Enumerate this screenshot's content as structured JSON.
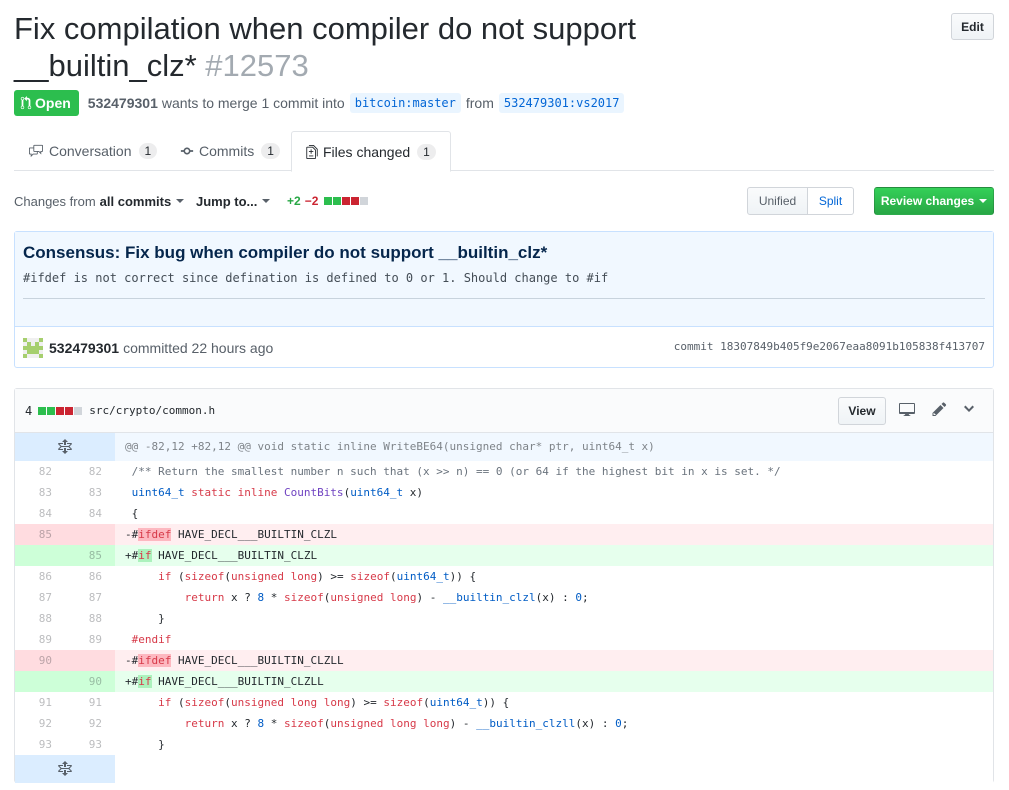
{
  "pr": {
    "title": "Fix compilation when compiler do not support __builtin_clz*",
    "number": "#12573",
    "state": "Open",
    "author": "532479301",
    "summary_prefix": "wants to merge 1 commit into",
    "base_branch": "bitcoin:master",
    "from_word": "from",
    "head_branch": "532479301:vs2017",
    "edit_label": "Edit"
  },
  "tabs": [
    {
      "label": "Conversation",
      "count": "1"
    },
    {
      "label": "Commits",
      "count": "1"
    },
    {
      "label": "Files changed",
      "count": "1"
    }
  ],
  "toolbar": {
    "changes_from": "Changes from",
    "changes_scope": "all commits",
    "jump_to": "Jump to...",
    "additions": "+2",
    "deletions": "−2",
    "unified": "Unified",
    "split": "Split",
    "review": "Review changes"
  },
  "commit": {
    "title": "Consensus: Fix bug when compiler do not support __builtin_clz*",
    "body": "#ifdef is not correct since defination is defined to 0 or 1. Should change to #if",
    "author": "532479301",
    "time": "committed 22 hours ago",
    "sha_label": "commit",
    "sha": "18307849b405f9e2067eaa8091b105838f413707"
  },
  "file": {
    "changes": "4",
    "path": "src/crypto/common.h",
    "view_label": "View",
    "hunk": "@@ -82,12 +82,12 @@ void static inline WriteBE64(unsigned char* ptr, uint64_t x)",
    "lines": [
      {
        "old": "82",
        "new": "82",
        "type": "ctx"
      },
      {
        "old": "83",
        "new": "83",
        "type": "ctx"
      },
      {
        "old": "84",
        "new": "84",
        "type": "ctx"
      },
      {
        "old": "85",
        "new": "",
        "type": "del"
      },
      {
        "old": "",
        "new": "85",
        "type": "add"
      },
      {
        "old": "86",
        "new": "86",
        "type": "ctx"
      },
      {
        "old": "87",
        "new": "87",
        "type": "ctx"
      },
      {
        "old": "88",
        "new": "88",
        "type": "ctx"
      },
      {
        "old": "89",
        "new": "89",
        "type": "ctx"
      },
      {
        "old": "90",
        "new": "",
        "type": "del"
      },
      {
        "old": "",
        "new": "90",
        "type": "add"
      },
      {
        "old": "91",
        "new": "91",
        "type": "ctx"
      },
      {
        "old": "92",
        "new": "92",
        "type": "ctx"
      },
      {
        "old": "93",
        "new": "93",
        "type": "ctx"
      }
    ],
    "code": {
      "l0_comment": "/** Return the smallest number n such that (x >> n) == 0 (or 64 if the highest bit in x is set. */",
      "l1_type": "uint64_t",
      "l1_kw": "static inline",
      "l1_fn": "CountBits",
      "l1_paren": "(",
      "l1_argtype": "uint64_t",
      "l1_rest": " x)",
      "l2": "{",
      "l3_prefix": "-#",
      "l3_kw": "ifdef",
      "l3_rest": " HAVE_DECL___BUILTIN_CLZL",
      "l4_prefix": "+#",
      "l4_kw": "if",
      "l4_rest": " HAVE_DECL___BUILTIN_CLZL",
      "l5_kw1": "if",
      "l5_a": " (",
      "l5_kw2": "sizeof",
      "l5_b": "(",
      "l5_kw3": "unsigned long",
      "l5_c": ") >= ",
      "l5_kw4": "sizeof",
      "l5_d": "(",
      "l5_t": "uint64_t",
      "l5_e": ")) {",
      "l6_kw1": "return",
      "l6_a": " x ? ",
      "l6_n": "8",
      "l6_b": " * ",
      "l6_kw2": "sizeof",
      "l6_c": "(",
      "l6_kw3": "unsigned long",
      "l6_d": ") - ",
      "l6_fn": "__builtin_clzl",
      "l6_e": "(x) : ",
      "l6_z": "0",
      "l6_f": ";",
      "l7": "}",
      "l8_kw": "#endif",
      "l9_prefix": "-#",
      "l9_kw": "ifdef",
      "l9_rest": " HAVE_DECL___BUILTIN_CLZLL",
      "l10_prefix": "+#",
      "l10_kw": "if",
      "l10_rest": " HAVE_DECL___BUILTIN_CLZLL",
      "l11_kw1": "if",
      "l11_a": " (",
      "l11_kw2": "sizeof",
      "l11_b": "(",
      "l11_kw3": "unsigned long long",
      "l11_c": ") >= ",
      "l11_kw4": "sizeof",
      "l11_d": "(",
      "l11_t": "uint64_t",
      "l11_e": ")) {",
      "l12_kw1": "return",
      "l12_a": " x ? ",
      "l12_n": "8",
      "l12_b": " * ",
      "l12_kw2": "sizeof",
      "l12_c": "(",
      "l12_kw3": "unsigned long long",
      "l12_d": ") - ",
      "l12_fn": "__builtin_clzll",
      "l12_e": "(x) : ",
      "l12_z": "0",
      "l12_f": ";",
      "l13": "}"
    }
  },
  "colors": {
    "open_green": "#2cbe4e",
    "link_blue": "#0366d6",
    "del_bg": "#ffeef0",
    "add_bg": "#e6ffed"
  }
}
